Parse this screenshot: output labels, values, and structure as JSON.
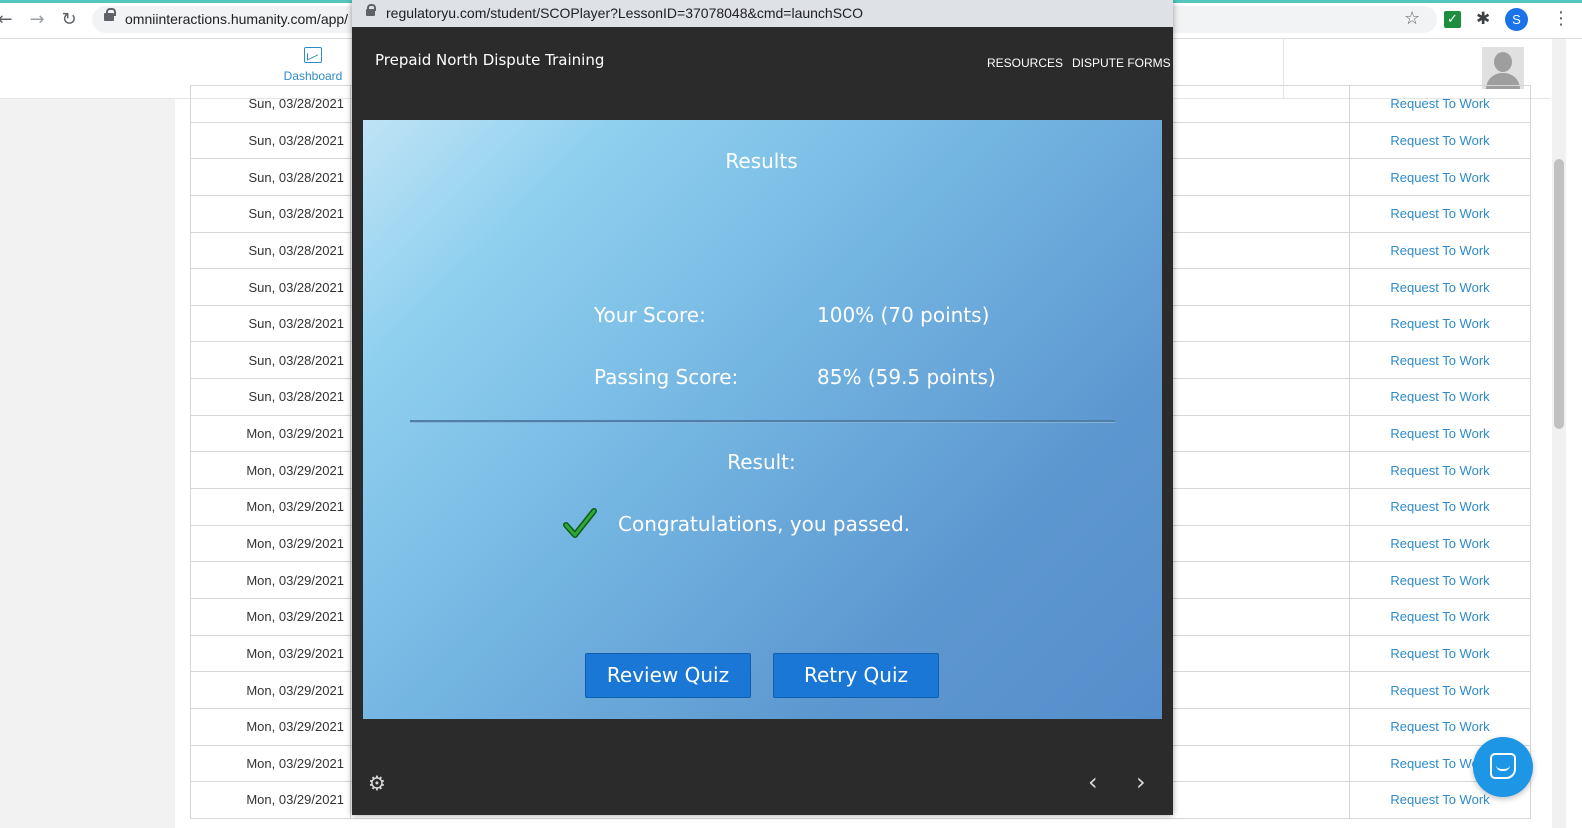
{
  "browser": {
    "url": "omniinteractions.humanity.com/app/",
    "profile_initial": "S",
    "accent_color": "#53c6c0"
  },
  "app": {
    "dashboard_label": "Dashboard",
    "link_color": "#2e8bc9"
  },
  "shifts": [
    {
      "date": "Sun, 03/28/2021",
      "action": "Request To Work"
    },
    {
      "date": "Sun, 03/28/2021",
      "action": "Request To Work"
    },
    {
      "date": "Sun, 03/28/2021",
      "action": "Request To Work"
    },
    {
      "date": "Sun, 03/28/2021",
      "action": "Request To Work"
    },
    {
      "date": "Sun, 03/28/2021",
      "action": "Request To Work"
    },
    {
      "date": "Sun, 03/28/2021",
      "action": "Request To Work"
    },
    {
      "date": "Sun, 03/28/2021",
      "action": "Request To Work"
    },
    {
      "date": "Sun, 03/28/2021",
      "action": "Request To Work"
    },
    {
      "date": "Sun, 03/28/2021",
      "action": "Request To Work"
    },
    {
      "date": "Mon, 03/29/2021",
      "action": "Request To Work"
    },
    {
      "date": "Mon, 03/29/2021",
      "action": "Request To Work"
    },
    {
      "date": "Mon, 03/29/2021",
      "action": "Request To Work"
    },
    {
      "date": "Mon, 03/29/2021",
      "action": "Request To Work"
    },
    {
      "date": "Mon, 03/29/2021",
      "action": "Request To Work"
    },
    {
      "date": "Mon, 03/29/2021",
      "action": "Request To Work"
    },
    {
      "date": "Mon, 03/29/2021",
      "action": "Request To Work"
    },
    {
      "date": "Mon, 03/29/2021",
      "action": "Request To Work"
    },
    {
      "date": "Mon, 03/29/2021",
      "action": "Request To Work"
    },
    {
      "date": "Mon, 03/29/2021",
      "action": "Request To Work"
    },
    {
      "date": "Mon, 03/29/2021",
      "action": "Request To Work"
    }
  ],
  "popup": {
    "url": "regulatoryu.com/student/SCOPlayer?LessonID=37078048&cmd=launchSCO",
    "player_title": "Prepaid North Dispute Training",
    "nav": {
      "resources": "RESOURCES",
      "dispute_forms": "DISPUTE FORMS"
    },
    "slide": {
      "title": "Results",
      "your_score_label": "Your Score:",
      "your_score_value": "100% (70 points)",
      "passing_score_label": "Passing Score:",
      "passing_score_value": "85% (59.5 points)",
      "result_label": "Result:",
      "result_message": "Congratulations, you passed.",
      "review_button": "Review Quiz",
      "retry_button": "Retry Quiz",
      "pass_color": "#1c8a24",
      "button_color": "#1b77d6"
    },
    "icons": {
      "settings": "gear-icon",
      "prev": "chevron-left-icon",
      "next": "chevron-right-icon"
    }
  }
}
